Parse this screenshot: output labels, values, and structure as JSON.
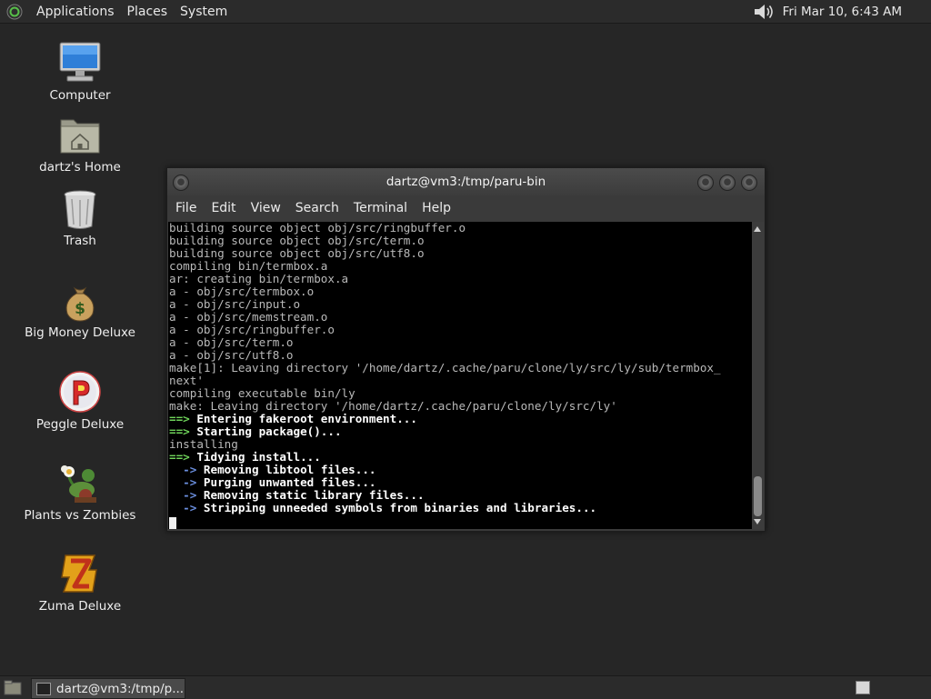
{
  "top_panel": {
    "menus": [
      "Applications",
      "Places",
      "System"
    ],
    "clock": "Fri Mar 10,  6:43 AM"
  },
  "desktop_icons": [
    {
      "label": "Computer",
      "icon": "computer-icon"
    },
    {
      "label": "dartz's Home",
      "icon": "home-folder-icon"
    },
    {
      "label": "Trash",
      "icon": "trash-icon"
    },
    {
      "label": "Big Money Deluxe",
      "icon": "money-bag-icon"
    },
    {
      "label": "Peggle Deluxe",
      "icon": "peggle-icon"
    },
    {
      "label": "Plants vs Zombies",
      "icon": "plants-vs-zombies-icon"
    },
    {
      "label": "Zuma Deluxe",
      "icon": "zuma-icon"
    }
  ],
  "terminal": {
    "title": "dartz@vm3:/tmp/paru-bin",
    "menu": [
      "File",
      "Edit",
      "View",
      "Search",
      "Terminal",
      "Help"
    ],
    "lines": [
      {
        "style": "dim",
        "text": "building source object obj/src/ringbuffer.o"
      },
      {
        "style": "dim",
        "text": "building source object obj/src/term.o"
      },
      {
        "style": "dim",
        "text": "building source object obj/src/utf8.o"
      },
      {
        "style": "dim",
        "text": "compiling bin/termbox.a"
      },
      {
        "style": "dim",
        "text": "ar: creating bin/termbox.a"
      },
      {
        "style": "dim",
        "text": "a - obj/src/termbox.o"
      },
      {
        "style": "dim",
        "text": "a - obj/src/input.o"
      },
      {
        "style": "dim",
        "text": "a - obj/src/memstream.o"
      },
      {
        "style": "dim",
        "text": "a - obj/src/ringbuffer.o"
      },
      {
        "style": "dim",
        "text": "a - obj/src/term.o"
      },
      {
        "style": "dim",
        "text": "a - obj/src/utf8.o"
      },
      {
        "style": "dim",
        "text": "make[1]: Leaving directory '/home/dartz/.cache/paru/clone/ly/src/ly/sub/termbox_"
      },
      {
        "style": "dim",
        "text": "next'"
      },
      {
        "style": "dim",
        "text": "compiling executable bin/ly"
      },
      {
        "style": "dim",
        "text": "make: Leaving directory '/home/dartz/.cache/paru/clone/ly/src/ly'"
      },
      {
        "style": "arrow",
        "prefix": "==>",
        "text": " Entering fakeroot environment..."
      },
      {
        "style": "arrow",
        "prefix": "==>",
        "text": " Starting package()..."
      },
      {
        "style": "dim",
        "text": "installing"
      },
      {
        "style": "arrow",
        "prefix": "==>",
        "text": " Tidying install..."
      },
      {
        "style": "sub",
        "prefix": "  ->",
        "text": " Removing libtool files..."
      },
      {
        "style": "sub",
        "prefix": "  ->",
        "text": " Purging unwanted files..."
      },
      {
        "style": "sub",
        "prefix": "  ->",
        "text": " Removing static library files..."
      },
      {
        "style": "sub",
        "prefix": "  ->",
        "text": " Stripping unneeded symbols from binaries and libraries..."
      }
    ]
  },
  "taskbar": {
    "task_label": "dartz@vm3:/tmp/p..."
  }
}
